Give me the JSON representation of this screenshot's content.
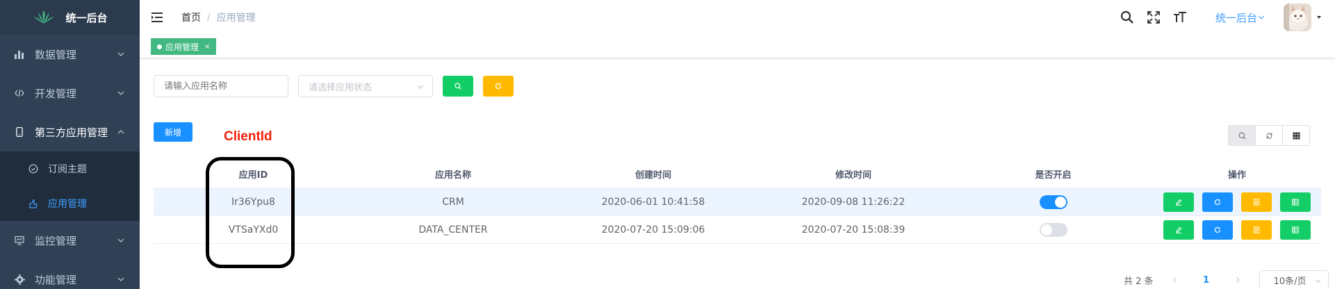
{
  "app": {
    "title": "统一后台"
  },
  "sidebar": {
    "items": [
      {
        "label": "数据管理",
        "icon": "bar-chart-icon"
      },
      {
        "label": "开发管理",
        "icon": "code-icon"
      },
      {
        "label": "第三方应用管理",
        "icon": "phone-icon",
        "expanded": true,
        "children": [
          {
            "label": "订阅主题",
            "icon": "circle-check-icon"
          },
          {
            "label": "应用管理",
            "icon": "hand-icon",
            "active": true
          }
        ]
      },
      {
        "label": "监控管理",
        "icon": "monitor-icon"
      },
      {
        "label": "功能管理",
        "icon": "settings-icon"
      }
    ]
  },
  "navbar": {
    "breadcrumb": {
      "home": "首页",
      "separator": "/",
      "current": "应用管理"
    },
    "user_menu": "统一后台"
  },
  "tags": {
    "active": {
      "label": "应用管理",
      "close": "×"
    }
  },
  "search": {
    "name_placeholder": "请输入应用名称",
    "status_placeholder": "请选择应用状态"
  },
  "toolbar": {
    "add_label": "新增"
  },
  "annotation": {
    "label": "ClientId"
  },
  "table": {
    "headers": [
      "应用ID",
      "应用名称",
      "创建时间",
      "修改时间",
      "是否开启",
      "操作"
    ],
    "rows": [
      {
        "id": "Ir36Ypu8",
        "name": "CRM",
        "created": "2020-06-01 10:41:58",
        "modified": "2020-09-08 11:26:22",
        "enabled": true
      },
      {
        "id": "VTSaYXd0",
        "name": "DATA_CENTER",
        "created": "2020-07-20 15:09:06",
        "modified": "2020-07-20 15:08:39",
        "enabled": false
      }
    ]
  },
  "pagination": {
    "total": "共 2 条",
    "current": "1",
    "page_size": "10条/页"
  },
  "colors": {
    "sidebar": "#304156",
    "primary": "#1890ff",
    "success": "#13ce66",
    "warning": "#ffba00",
    "tag": "#42b983",
    "annotation": "#f41e0b"
  }
}
